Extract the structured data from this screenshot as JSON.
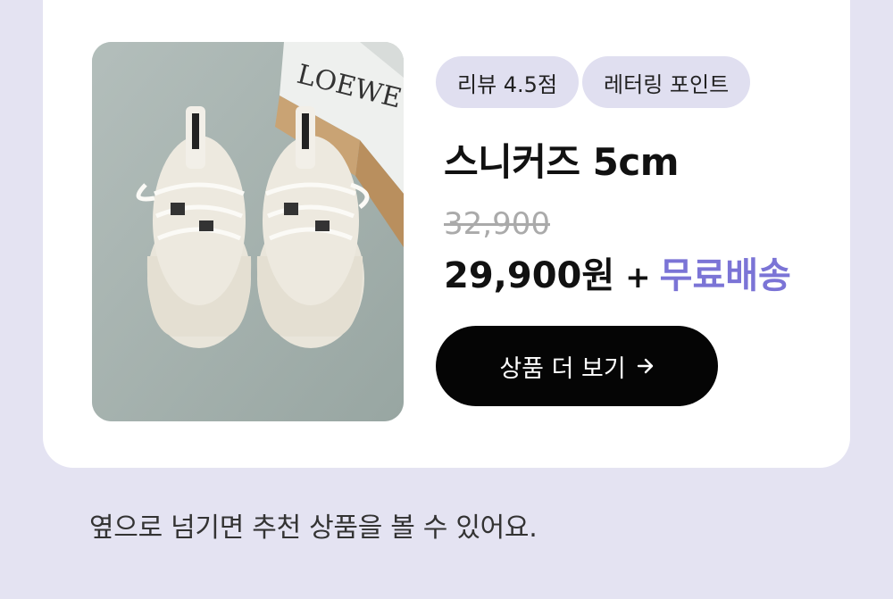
{
  "product": {
    "badges": [
      "리뷰 4.5점",
      "레터링 포인트"
    ],
    "name": "스니커즈 5cm",
    "original_price": "32,900",
    "sale_price": "29,900원",
    "plus_sign": "+",
    "shipping": "무료배송",
    "cta_label": "상품 더 보기",
    "image_box_text": "LOEWE",
    "accent_color": "#7b74d6"
  },
  "footer": {
    "hint": "옆으로 넘기면 추천 상품을 볼 수 있어요."
  }
}
